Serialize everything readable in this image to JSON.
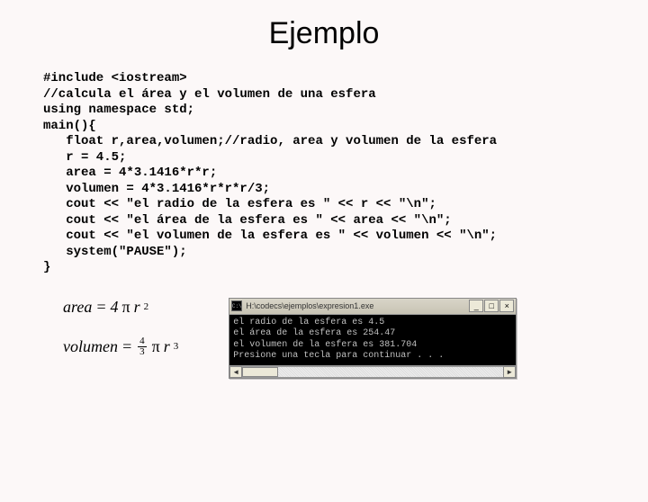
{
  "title": "Ejemplo",
  "code": "#include <iostream>\n//calcula el área y el volumen de una esfera\nusing namespace std;\nmain(){\n   float r,area,volumen;//radio, area y volumen de la esfera\n   r = 4.5;\n   area = 4*3.1416*r*r;\n   volumen = 4*3.1416*r*r*r/3;\n   cout << \"el radio de la esfera es \" << r << \"\\n\";\n   cout << \"el área de la esfera es \" << area << \"\\n\";\n   cout << \"el volumen de la esfera es \" << volumen << \"\\n\";\n   system(\"PAUSE\");\n}",
  "formulas": {
    "area_lhs": "area",
    "area_eq": "=",
    "area_coef": "4",
    "area_pi": "π",
    "area_var": "r",
    "area_exp": "2",
    "vol_lhs": "volumen",
    "vol_eq": "=",
    "vol_frac_num": "4",
    "vol_frac_den": "3",
    "vol_pi": "π",
    "vol_var": "r",
    "vol_exp": "3"
  },
  "console": {
    "title": "H:\\codecs\\ejemplos\\expresion1.exe",
    "min": "_",
    "max": "□",
    "close": "×",
    "output": "el radio de la esfera es 4.5\nel área de la esfera es 254.47\nel volumen de la esfera es 381.704\nPresione una tecla para continuar . . .",
    "scroll_left": "◄",
    "scroll_right": "►"
  }
}
